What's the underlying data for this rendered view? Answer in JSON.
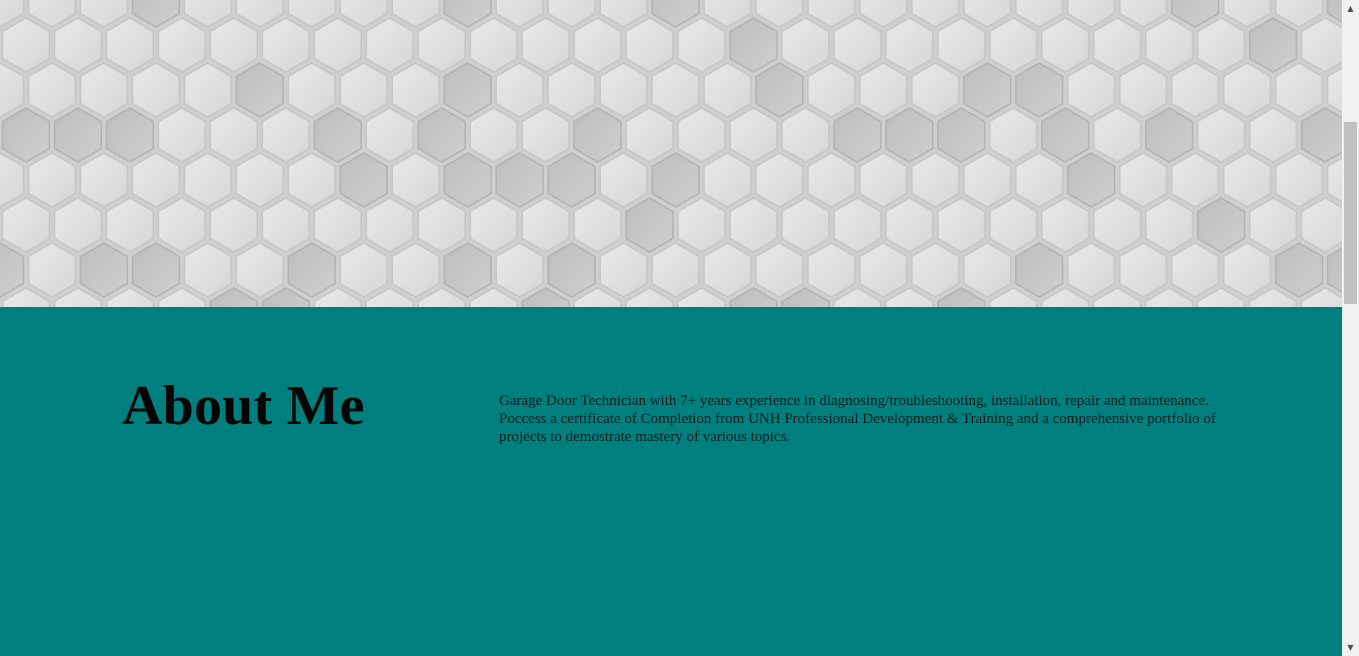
{
  "hero": {
    "background_image": "hexagon-tile-pattern"
  },
  "about": {
    "title": "About Me",
    "text": "Garage Door Technician with 7+ years experience in diagnosing/troubleshooting, installation, repair and maintenance. Poccess a certificate of Completion from UNH Professional Development & Training and a comprehensive portfolio of projects to demostrate mastery of various topics.",
    "background_color": "#007f7f"
  },
  "scrollbar": {
    "up_icon": "arrow-up-icon",
    "down_icon": "arrow-down-icon"
  }
}
